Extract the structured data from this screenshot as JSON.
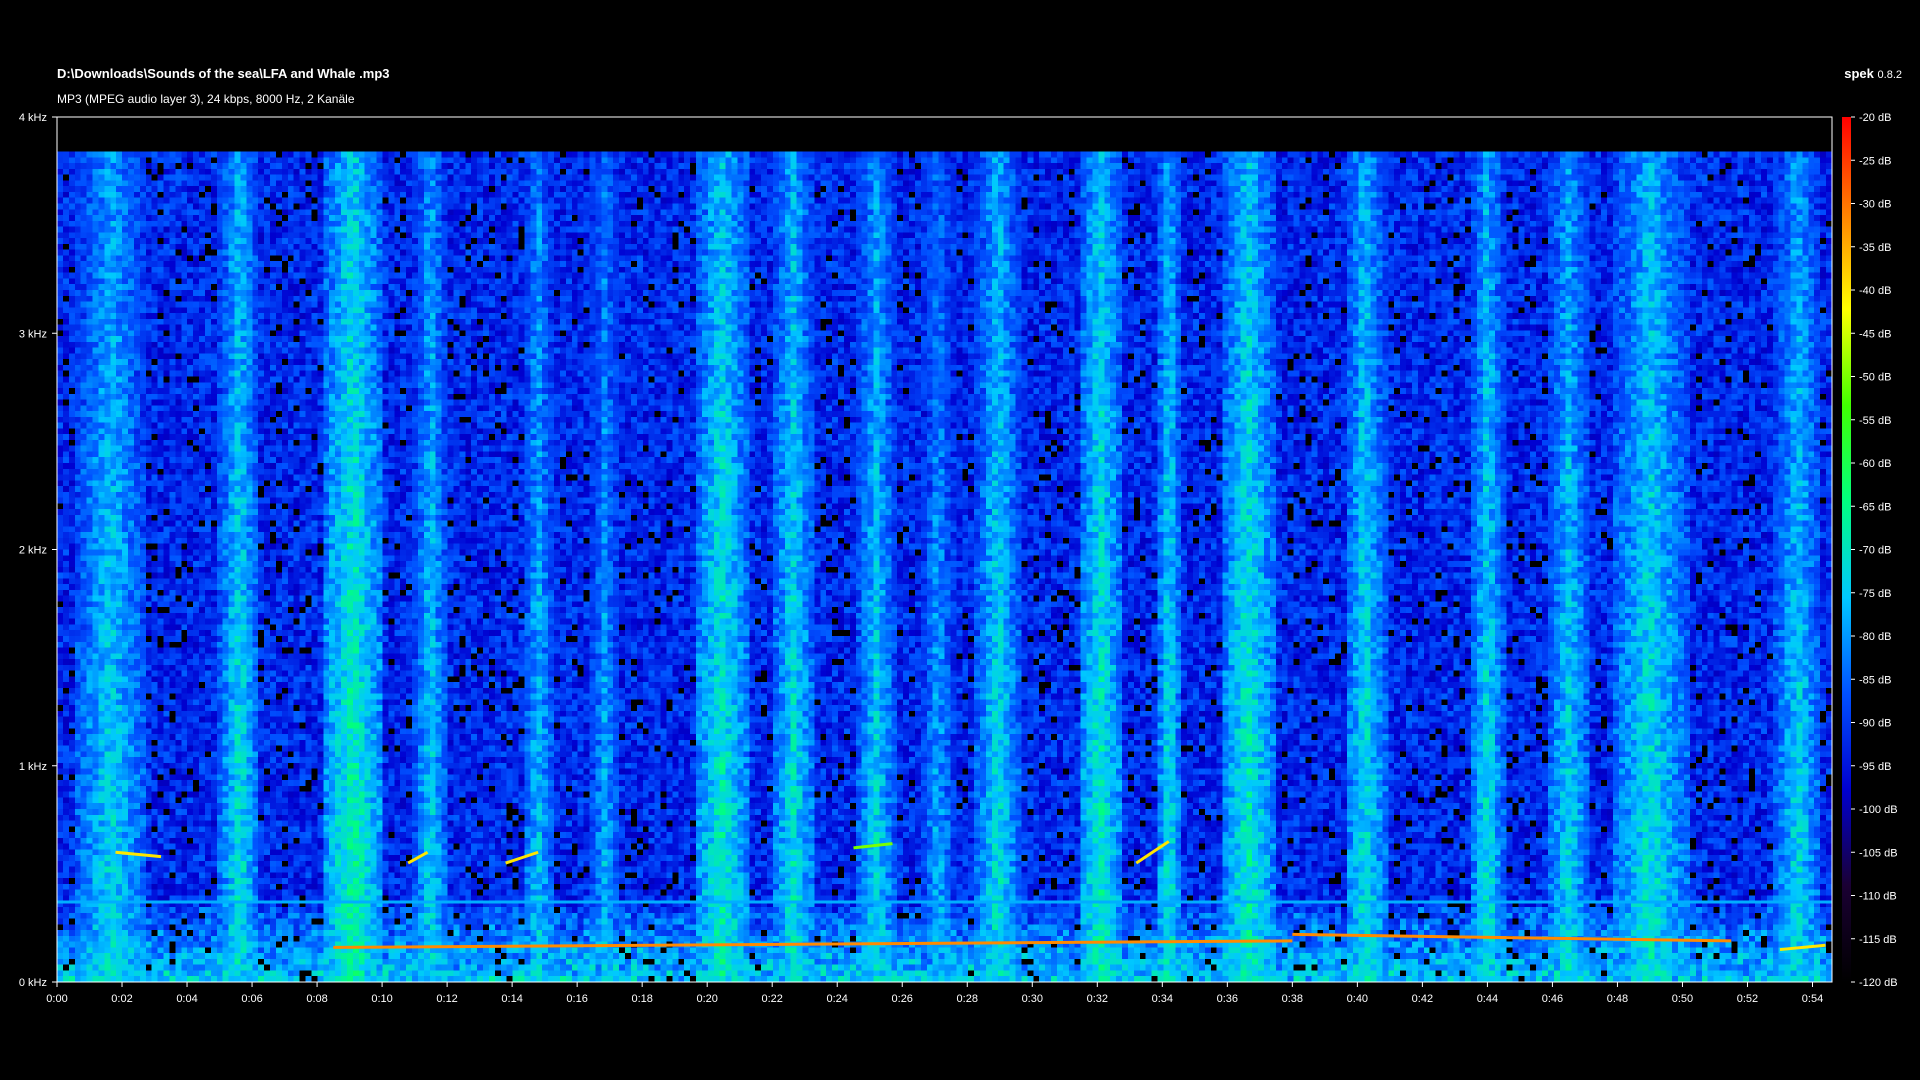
{
  "header": {
    "file_path": "D:\\Downloads\\Sounds of the sea\\LFA and Whale .mp3",
    "file_info": "MP3 (MPEG audio layer 3), 24 kbps, 8000 Hz, 2 Kanäle",
    "app_name": "spek",
    "app_version": "0.8.2"
  },
  "chart_data": {
    "type": "heatmap",
    "title": "",
    "xlabel": "",
    "ylabel": "",
    "x_ticks": [
      "0:00",
      "0:02",
      "0:04",
      "0:06",
      "0:08",
      "0:10",
      "0:12",
      "0:14",
      "0:16",
      "0:18",
      "0:20",
      "0:22",
      "0:24",
      "0:26",
      "0:28",
      "0:30",
      "0:32",
      "0:34",
      "0:36",
      "0:38",
      "0:40",
      "0:42",
      "0:44",
      "0:46",
      "0:48",
      "0:50",
      "0:52",
      "0:54"
    ],
    "x_range_seconds": [
      0,
      54.6
    ],
    "y_ticks": [
      "0 kHz",
      "1 kHz",
      "2 kHz",
      "3 kHz",
      "4 kHz"
    ],
    "y_range_khz": [
      0,
      4
    ],
    "colorbar_ticks": [
      "-20 dB",
      "-25 dB",
      "-30 dB",
      "-35 dB",
      "-40 dB",
      "-45 dB",
      "-50 dB",
      "-55 dB",
      "-60 dB",
      "-65 dB",
      "-70 dB",
      "-75 dB",
      "-80 dB",
      "-85 dB",
      "-90 dB",
      "-95 dB",
      "-100 dB",
      "-105 dB",
      "-110 dB",
      "-115 dB",
      "-120 dB"
    ],
    "colorbar_range_db": [
      -120,
      -20
    ],
    "colormap": [
      "#000000",
      "#1a0033",
      "#0000d0",
      "#0050ff",
      "#00c8ff",
      "#00ff80",
      "#40ff00",
      "#ffff00",
      "#ff8000",
      "#ff0000"
    ],
    "noise_floor_db": -92,
    "content_top_khz": 3.85,
    "vocal_bursts_seconds": [
      {
        "start": 0.5,
        "end": 2.8,
        "level_db": -72
      },
      {
        "start": 5.0,
        "end": 6.2,
        "level_db": -70
      },
      {
        "start": 8.2,
        "end": 10.0,
        "level_db": -66
      },
      {
        "start": 11.0,
        "end": 12.0,
        "level_db": -72
      },
      {
        "start": 14.3,
        "end": 15.3,
        "level_db": -74
      },
      {
        "start": 16.4,
        "end": 17.3,
        "level_db": -76
      },
      {
        "start": 19.6,
        "end": 21.3,
        "level_db": -68
      },
      {
        "start": 22.0,
        "end": 23.3,
        "level_db": -70
      },
      {
        "start": 24.6,
        "end": 25.8,
        "level_db": -72
      },
      {
        "start": 26.6,
        "end": 27.6,
        "level_db": -76
      },
      {
        "start": 28.3,
        "end": 29.6,
        "level_db": -70
      },
      {
        "start": 31.4,
        "end": 32.8,
        "level_db": -68
      },
      {
        "start": 33.8,
        "end": 34.6,
        "level_db": -70
      },
      {
        "start": 35.8,
        "end": 37.5,
        "level_db": -68
      },
      {
        "start": 39.6,
        "end": 40.9,
        "level_db": -70
      },
      {
        "start": 43.5,
        "end": 44.5,
        "level_db": -70
      },
      {
        "start": 45.8,
        "end": 47.2,
        "level_db": -72
      },
      {
        "start": 47.8,
        "end": 50.2,
        "level_db": -70
      },
      {
        "start": 52.8,
        "end": 54.3,
        "level_db": -72
      }
    ],
    "tonal_lines": [
      {
        "from_s": 0,
        "to_s": 54.6,
        "from_khz": 0.37,
        "to_khz": 0.37,
        "level_db": -78
      },
      {
        "from_s": 8.5,
        "to_s": 38.0,
        "from_khz": 0.16,
        "to_khz": 0.19,
        "level_db": -32
      },
      {
        "from_s": 38.0,
        "to_s": 51.5,
        "from_khz": 0.22,
        "to_khz": 0.19,
        "level_db": -32
      },
      {
        "from_s": 53.0,
        "to_s": 54.4,
        "from_khz": 0.15,
        "to_khz": 0.17,
        "level_db": -40
      },
      {
        "from_s": 1.8,
        "to_s": 3.2,
        "from_khz": 0.6,
        "to_khz": 0.58,
        "level_db": -40
      },
      {
        "from_s": 10.8,
        "to_s": 11.4,
        "from_khz": 0.55,
        "to_khz": 0.6,
        "level_db": -40
      },
      {
        "from_s": 13.8,
        "to_s": 14.8,
        "from_khz": 0.55,
        "to_khz": 0.6,
        "level_db": -40
      },
      {
        "from_s": 24.5,
        "to_s": 25.7,
        "from_khz": 0.62,
        "to_khz": 0.64,
        "level_db": -50
      },
      {
        "from_s": 33.2,
        "to_s": 34.2,
        "from_khz": 0.55,
        "to_khz": 0.65,
        "level_db": -40
      }
    ]
  }
}
